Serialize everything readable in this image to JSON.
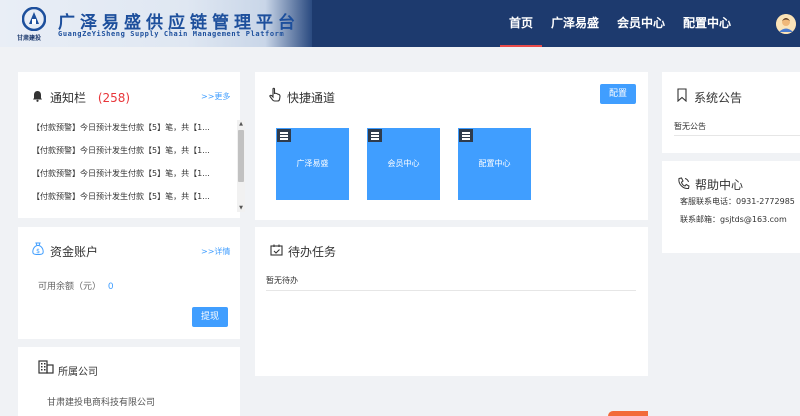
{
  "header": {
    "brand_title": "广泽易盛供应链管理平台",
    "brand_subtitle": "GuangZeYiSheng Supply Chain Management Platform",
    "logo_caption": "甘肃建投",
    "nav": [
      {
        "label": "首页",
        "active": true
      },
      {
        "label": "广泽易盛",
        "active": false
      },
      {
        "label": "会员中心",
        "active": false
      },
      {
        "label": "配置中心",
        "active": false
      }
    ]
  },
  "notice": {
    "title": "通知栏",
    "count": "(258)",
    "more": ">>更多",
    "items": [
      "【付款预警】今日预计发生付款【5】笔，共【1...",
      "【付款预警】今日预计发生付款【5】笔，共【1...",
      "【付款预警】今日预计发生付款【5】笔，共【1...",
      "【付款预警】今日预计发生付款【5】笔，共【1..."
    ]
  },
  "account": {
    "title": "资金账户",
    "more": ">>详情",
    "balance_label": "可用余额（元）",
    "balance_value": "0",
    "withdraw": "提现"
  },
  "company": {
    "title": "所属公司",
    "name": "甘肃建投电商科技有限公司"
  },
  "quick": {
    "title": "快捷通道",
    "config": "配置",
    "tiles": [
      "广泽易盛",
      "会员中心",
      "配置中心"
    ]
  },
  "todo": {
    "title": "待办任务",
    "empty": "暂无待办"
  },
  "announcement": {
    "title": "系统公告",
    "empty": "暂无公告"
  },
  "help": {
    "title": "帮助中心",
    "phone": "客服联系电话：0931-2772985",
    "email": "联系邮箱：gsjtds@163.com"
  },
  "colors": {
    "header_bg": "#1d3a6e",
    "accent": "#409eff",
    "count_red": "#e8363a"
  }
}
